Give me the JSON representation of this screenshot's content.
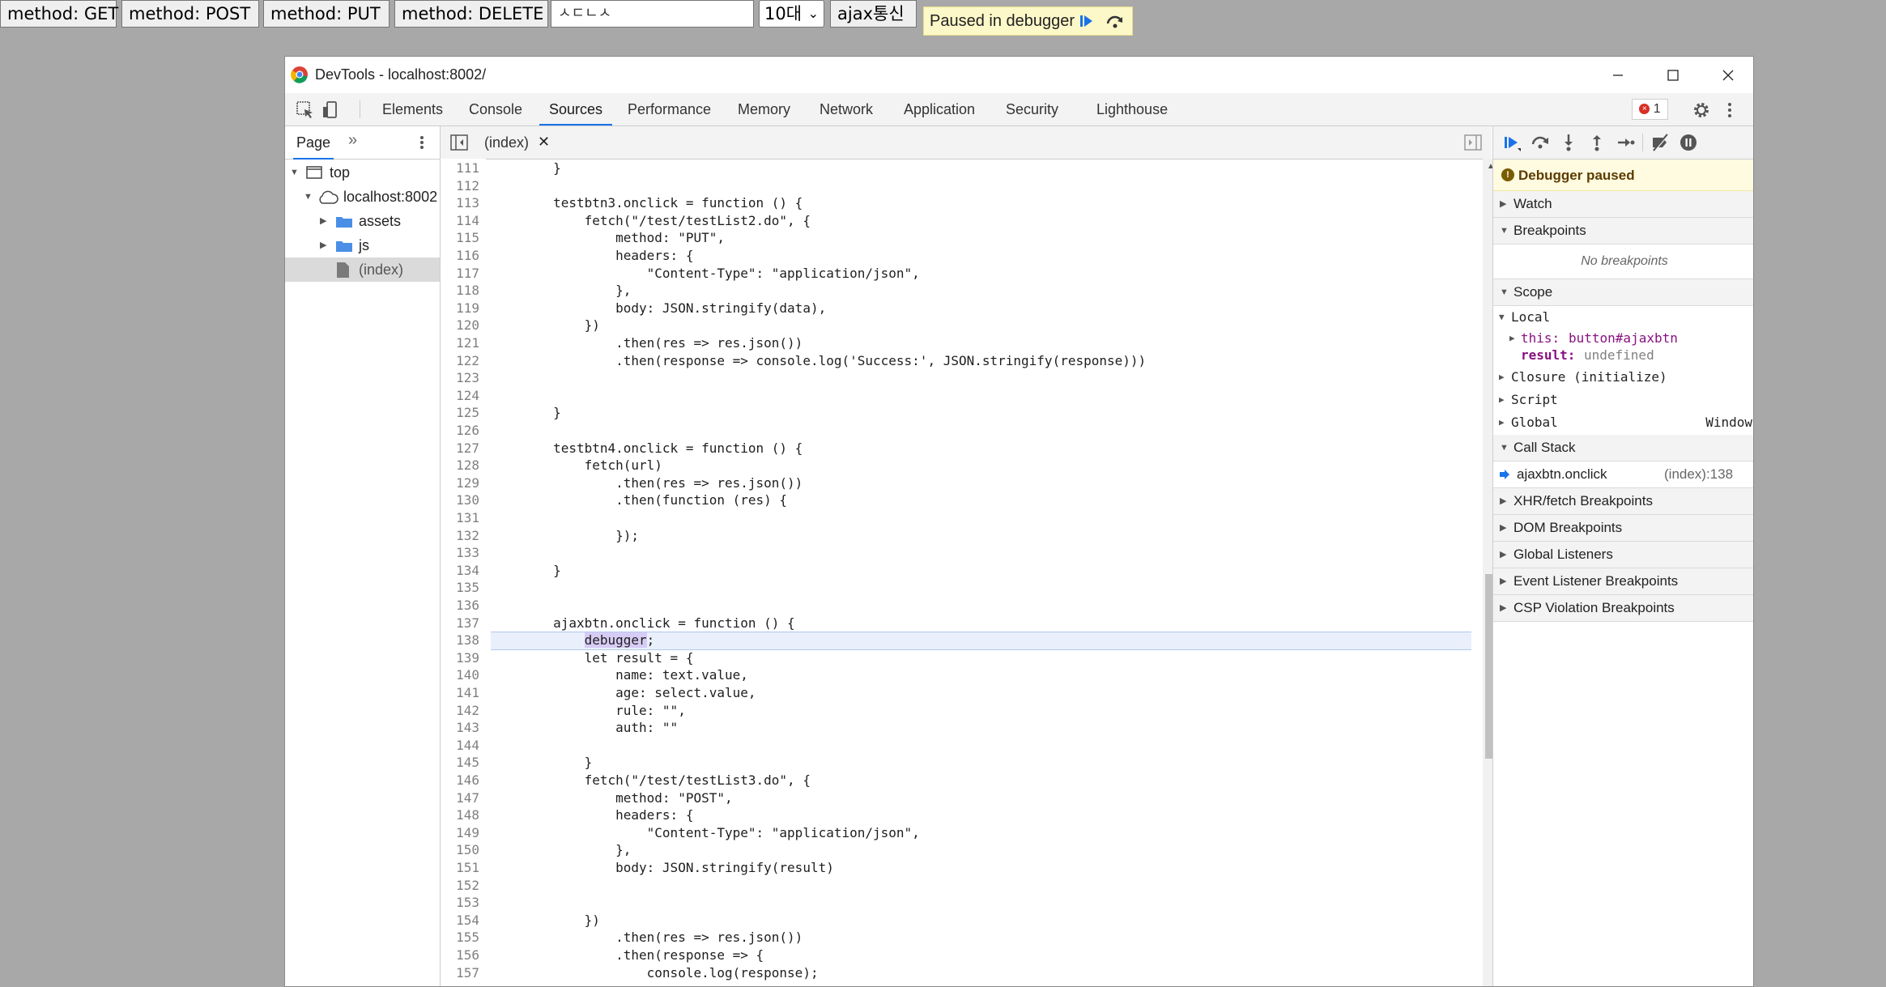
{
  "page": {
    "buttons": [
      "method: GET",
      "method: POST",
      "method: PUT",
      "method: DELETE"
    ],
    "text_input_value": "ㅅㄷㄴㅅ",
    "select_value": "10대",
    "ajax_button": "ajax통신",
    "paused_label": "Paused in debugger"
  },
  "window": {
    "title": "DevTools - localhost:8002/"
  },
  "tabs": [
    "Elements",
    "Console",
    "Sources",
    "Performance",
    "Memory",
    "Network",
    "Application",
    "Security",
    "Lighthouse"
  ],
  "active_tab": "Sources",
  "error_count": "1",
  "navigator": {
    "tab": "Page",
    "items": [
      "top",
      "localhost:8002",
      "assets",
      "js",
      "(index)"
    ]
  },
  "editor": {
    "file_tab": "(index)"
  },
  "code_lines": [
    {
      "n": "111",
      "t": "        }"
    },
    {
      "n": "112",
      "t": ""
    },
    {
      "n": "113",
      "t": "        testbtn3.onclick = function () {"
    },
    {
      "n": "114",
      "t": "            fetch(\"/test/testList2.do\", {"
    },
    {
      "n": "115",
      "t": "                method: \"PUT\","
    },
    {
      "n": "116",
      "t": "                headers: {"
    },
    {
      "n": "117",
      "t": "                    \"Content-Type\": \"application/json\","
    },
    {
      "n": "118",
      "t": "                },"
    },
    {
      "n": "119",
      "t": "                body: JSON.stringify(data),"
    },
    {
      "n": "120",
      "t": "            })"
    },
    {
      "n": "121",
      "t": "                .then(res => res.json())"
    },
    {
      "n": "122",
      "t": "                .then(response => console.log('Success:', JSON.stringify(response)))"
    },
    {
      "n": "123",
      "t": ""
    },
    {
      "n": "124",
      "t": ""
    },
    {
      "n": "125",
      "t": "        }"
    },
    {
      "n": "126",
      "t": ""
    },
    {
      "n": "127",
      "t": "        testbtn4.onclick = function () {"
    },
    {
      "n": "128",
      "t": "            fetch(url)"
    },
    {
      "n": "129",
      "t": "                .then(res => res.json())"
    },
    {
      "n": "130",
      "t": "                .then(function (res) {"
    },
    {
      "n": "131",
      "t": ""
    },
    {
      "n": "132",
      "t": "                });"
    },
    {
      "n": "133",
      "t": ""
    },
    {
      "n": "134",
      "t": "        }"
    },
    {
      "n": "135",
      "t": ""
    },
    {
      "n": "136",
      "t": ""
    },
    {
      "n": "137",
      "t": "        ajaxbtn.onclick = function () {"
    },
    {
      "n": "138",
      "t": "            debugger;"
    },
    {
      "n": "139",
      "t": "            let result = {"
    },
    {
      "n": "140",
      "t": "                name: text.value,"
    },
    {
      "n": "141",
      "t": "                age: select.value,"
    },
    {
      "n": "142",
      "t": "                rule: \"\","
    },
    {
      "n": "143",
      "t": "                auth: \"\""
    },
    {
      "n": "144",
      "t": ""
    },
    {
      "n": "145",
      "t": "            }"
    },
    {
      "n": "146",
      "t": "            fetch(\"/test/testList3.do\", {"
    },
    {
      "n": "147",
      "t": "                method: \"POST\","
    },
    {
      "n": "148",
      "t": "                headers: {"
    },
    {
      "n": "149",
      "t": "                    \"Content-Type\": \"application/json\","
    },
    {
      "n": "150",
      "t": "                },"
    },
    {
      "n": "151",
      "t": "                body: JSON.stringify(result)"
    },
    {
      "n": "152",
      "t": ""
    },
    {
      "n": "153",
      "t": ""
    },
    {
      "n": "154",
      "t": "            })"
    },
    {
      "n": "155",
      "t": "                .then(res => res.json())"
    },
    {
      "n": "156",
      "t": "                .then(response => {"
    },
    {
      "n": "157",
      "t": "                    console.log(response);"
    }
  ],
  "debugger": {
    "paused_banner": "Debugger paused",
    "watch": "Watch",
    "breakpoints": "Breakpoints",
    "no_breakpoints": "No breakpoints",
    "scope": "Scope",
    "local": "Local",
    "this_key": "this:",
    "this_val": "button#ajaxbtn",
    "result_key": "result:",
    "result_val": "undefined",
    "closure": "Closure (initialize)",
    "script": "Script",
    "global": "Global",
    "global_val": "Window",
    "call_stack": "Call Stack",
    "frame_name": "ajaxbtn.onclick",
    "frame_loc": "(index):138",
    "xhr": "XHR/fetch Breakpoints",
    "dom": "DOM Breakpoints",
    "global_listeners": "Global Listeners",
    "event_listener": "Event Listener Breakpoints",
    "csp": "CSP Violation Breakpoints"
  }
}
